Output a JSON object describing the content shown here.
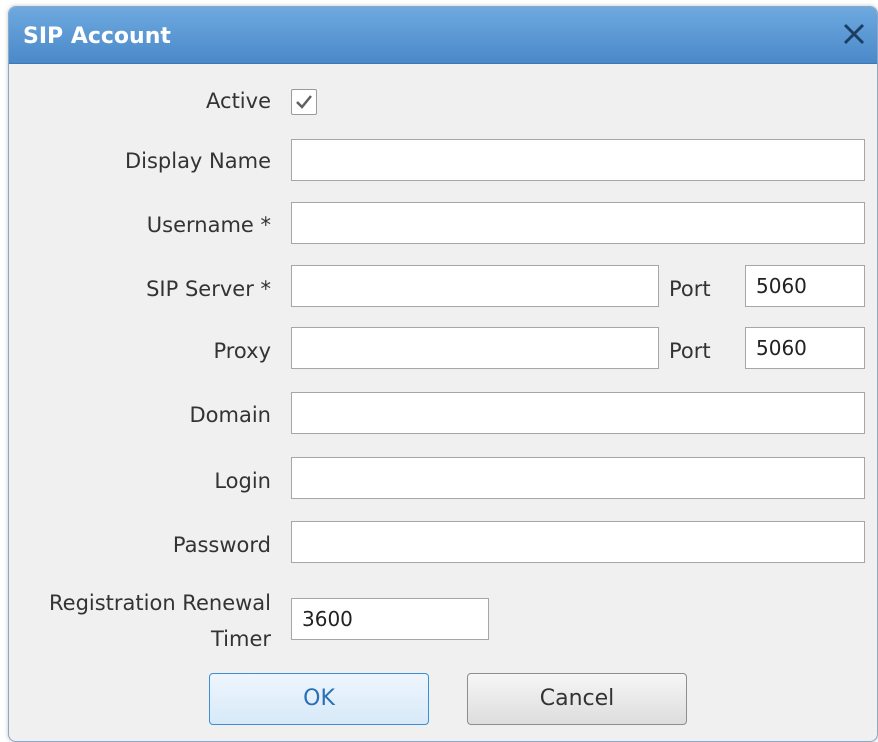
{
  "dialog": {
    "title": "SIP Account",
    "close_icon": "close-icon"
  },
  "form": {
    "active": {
      "label": "Active",
      "checked": true
    },
    "display_name": {
      "label": "Display Name",
      "value": ""
    },
    "username": {
      "label": "Username *",
      "value": ""
    },
    "sip_server": {
      "label": "SIP Server *",
      "value": "",
      "port_label": "Port",
      "port_value": "5060"
    },
    "proxy": {
      "label": "Proxy",
      "value": "",
      "port_label": "Port",
      "port_value": "5060"
    },
    "domain": {
      "label": "Domain",
      "value": ""
    },
    "login": {
      "label": "Login",
      "value": ""
    },
    "password": {
      "label": "Password",
      "value": ""
    },
    "registration_timer": {
      "label_line1": "Registration Renewal",
      "label_line2": "Timer",
      "value": "3600"
    }
  },
  "buttons": {
    "ok": "OK",
    "cancel": "Cancel"
  },
  "colors": {
    "titlebar": "#5a97d4",
    "ok_border": "#3c8fd3"
  }
}
